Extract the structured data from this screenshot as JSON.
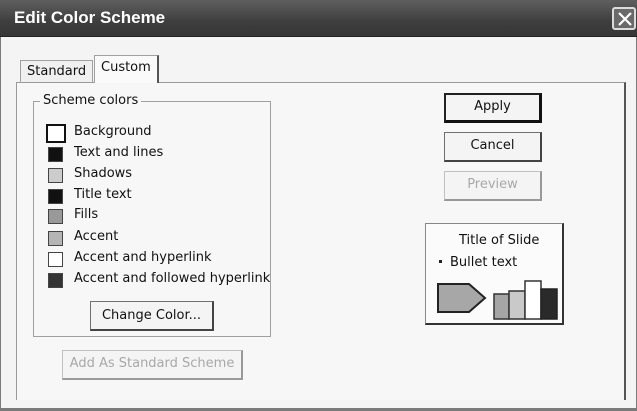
{
  "window": {
    "title": "Edit Color Scheme"
  },
  "tabs": [
    {
      "label": "Standard",
      "active": false
    },
    {
      "label": "Custom",
      "active": true
    }
  ],
  "scheme": {
    "group_label": "Scheme colors",
    "items": [
      {
        "label": "Background",
        "color": "#ffffff",
        "selected": true
      },
      {
        "label": "Text and lines",
        "color": "#111111"
      },
      {
        "label": "Shadows",
        "color": "#cccccc"
      },
      {
        "label": "Title text",
        "color": "#111111"
      },
      {
        "label": "Fills",
        "color": "#999999"
      },
      {
        "label": "Accent",
        "color": "#b5b5b5"
      },
      {
        "label": "Accent and hyperlink",
        "color": "#ffffff"
      },
      {
        "label": "Accent and followed hyperlink",
        "color": "#333333"
      }
    ],
    "change_color_label": "Change Color..."
  },
  "buttons": {
    "apply": "Apply",
    "cancel": "Cancel",
    "preview": "Preview",
    "add_standard": "Add As Standard Scheme"
  },
  "preview": {
    "title": "Title of Slide",
    "bullet": "Bullet text"
  },
  "icons": {
    "close": "close-icon",
    "arrow_shape": "arrow-shape-icon",
    "bar_chart": "bar-chart-icon"
  }
}
